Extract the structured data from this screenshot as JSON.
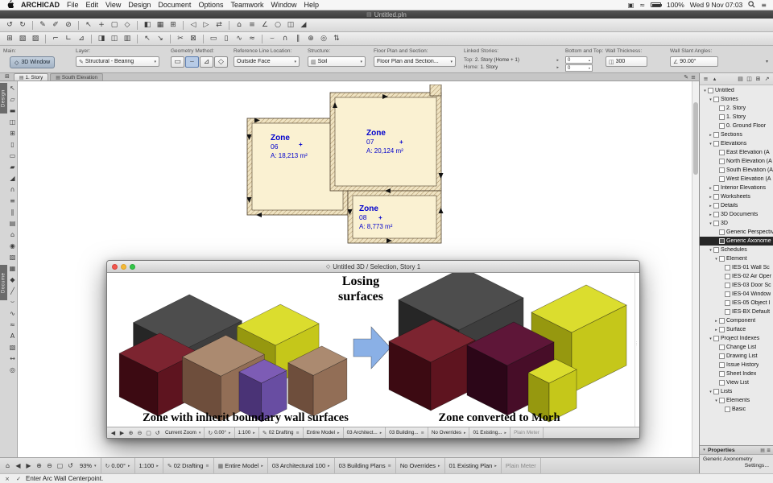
{
  "glyphs": {
    "chev_down": "▾",
    "chev_right": "▸",
    "chev_up": "▴",
    "menu": "≡",
    "cube": "◇",
    "pencil": "✎",
    "layers": "▥",
    "wall": "◫",
    "angle": "∠",
    "doc": "▤",
    "grid": "⊞",
    "wifi": "≈",
    "display": "▣",
    "dots": "⋮"
  },
  "colors": {
    "selection_highlight": "#262626",
    "zone_fill": "#faf1d2",
    "wall_hatch": "#a98f62",
    "zone_text": "#0000cd",
    "annotation_arrow_fill": "#8ab0e6",
    "annotation_arrow_stroke": "#3a66b0",
    "block_gray": "#4d4d4d",
    "block_maroon": "#5e141f",
    "block_brown": "#926e56",
    "block_purple": "#684da2",
    "block_yellow": "#c5c71a",
    "block_plum": "#470d28",
    "traffic_red": "#f2564d",
    "traffic_yellow": "#f5b935",
    "traffic_green": "#33c748"
  },
  "menubar": {
    "app_name": "ARCHICAD",
    "items": [
      "File",
      "Edit",
      "View",
      "Design",
      "Document",
      "Options",
      "Teamwork",
      "Window",
      "Help"
    ],
    "battery": "100%",
    "clock": "Wed 9 Nov 07:03"
  },
  "titlebar": {
    "title": "Untitled.pln"
  },
  "toolbar1_icons": [
    {
      "n": "undo-icon",
      "g": "↺"
    },
    {
      "n": "redo-icon",
      "g": "↻"
    },
    {
      "n": "separator"
    },
    {
      "n": "pen-icon",
      "g": "✎"
    },
    {
      "n": "pencil-icon",
      "g": "✐"
    },
    {
      "n": "eraser-icon",
      "g": "⊘"
    },
    {
      "n": "separator"
    },
    {
      "n": "arrow-select-icon",
      "g": "↖"
    },
    {
      "n": "add-vertex-icon",
      "g": "+"
    },
    {
      "n": "marquee-icon",
      "g": "▢"
    },
    {
      "n": "polygon-select-icon",
      "g": "◇"
    },
    {
      "n": "separator"
    },
    {
      "n": "layers-icon",
      "g": "◧"
    },
    {
      "n": "mesh-grid-icon",
      "g": "▦"
    },
    {
      "n": "snap-grid-icon",
      "g": "⊞"
    },
    {
      "n": "separator"
    },
    {
      "n": "previous-view-icon",
      "g": "◁"
    },
    {
      "n": "next-view-icon",
      "g": "▷"
    },
    {
      "n": "swap-view-icon",
      "g": "⇄"
    },
    {
      "n": "separator"
    },
    {
      "n": "home-story-icon",
      "g": "⌂"
    },
    {
      "n": "story-list-icon",
      "g": "≡"
    },
    {
      "n": "angle-icon",
      "g": "∠"
    },
    {
      "n": "circle-icon",
      "g": "○"
    },
    {
      "n": "door-icon",
      "g": "◫"
    },
    {
      "n": "roof-icon",
      "g": "◢"
    }
  ],
  "toolbar2_icons": [
    {
      "n": "grid-icon",
      "g": "⊞"
    },
    {
      "n": "hatch-icon",
      "g": "▧"
    },
    {
      "n": "hatch-alt-icon",
      "g": "▨"
    },
    {
      "n": "separator"
    },
    {
      "n": "trim-icon",
      "g": "⌐"
    },
    {
      "n": "adjust-icon",
      "g": "∟"
    },
    {
      "n": "slant-icon",
      "g": "⊿"
    },
    {
      "n": "separator"
    },
    {
      "n": "split-icon",
      "g": "◨"
    },
    {
      "n": "door-alt-icon",
      "g": "◫"
    },
    {
      "n": "layers-alt-icon",
      "g": "▥"
    },
    {
      "n": "separator"
    },
    {
      "n": "drag-icon",
      "g": "↖"
    },
    {
      "n": "stretch-icon",
      "g": "↘"
    },
    {
      "n": "separator"
    },
    {
      "n": "scissors-icon",
      "g": "✂"
    },
    {
      "n": "intersect-icon",
      "g": "⊠"
    },
    {
      "n": "separator"
    },
    {
      "n": "rectangle-icon",
      "g": "▭"
    },
    {
      "n": "column-icon",
      "g": "▯"
    },
    {
      "n": "polyline-icon",
      "g": "∿"
    },
    {
      "n": "spline-icon",
      "g": "≈"
    },
    {
      "n": "separator"
    },
    {
      "n": "arc-icon",
      "g": "⌣"
    },
    {
      "n": "shell-icon",
      "g": "∩"
    },
    {
      "n": "parallel-icon",
      "g": "∥"
    },
    {
      "n": "zoom-add-icon",
      "g": "⊕"
    },
    {
      "n": "camera-icon",
      "g": "◎"
    },
    {
      "n": "order-icon",
      "g": "⇅"
    }
  ],
  "infobox": {
    "section_label": "Main:",
    "tool_button": "3D Window",
    "layer_label": "Layer:",
    "layer_value": "Structural - Bearing",
    "geometry_label": "Geometry Method:",
    "geometry_buttons": [
      {
        "n": "geometry-straight-icon",
        "g": "▭"
      },
      {
        "n": "geometry-curved-icon",
        "g": "⌣",
        "sel": true
      },
      {
        "n": "geometry-trapezoid-icon",
        "g": "⊿"
      },
      {
        "n": "geometry-polygon-icon",
        "g": "◇"
      }
    ],
    "refline_label": "Reference Line Location:",
    "refline_value": "Outside Face",
    "structure_label": "Structure:",
    "structure_value": "Soil",
    "floorplan_label": "Floor Plan and Section:",
    "floorplan_value": "Floor Plan and Section...",
    "linked_label": "Linked Stories:",
    "top_label": "Top:",
    "top_value": "2. Story (Home + 1)",
    "home_label": "Home:",
    "home_value": "1. Story",
    "offsets_label": "Bottom and Top:",
    "offset_top": "0",
    "offset_bottom": "0",
    "thickness_label": "Wall Thickness:",
    "thickness_value": "300",
    "slant_label": "Wall Slant Angles:",
    "slant_value": "90.00°"
  },
  "tabs": {
    "active": "1. Story",
    "inactive": "South Elevation"
  },
  "toolbox": {
    "section_design": "Design",
    "section_document": "Docume",
    "icons": [
      {
        "n": "arrow-tool-icon",
        "g": "↖"
      },
      {
        "n": "marquee-tool-icon",
        "g": "▱"
      },
      {
        "n": "wall-tool-icon",
        "g": "▬"
      },
      {
        "n": "door-tool-icon",
        "g": "◫"
      },
      {
        "n": "window-tool-icon",
        "g": "⊞"
      },
      {
        "n": "column-tool-icon",
        "g": "▯"
      },
      {
        "n": "beam-tool-icon",
        "g": "▭"
      },
      {
        "n": "slab-tool-icon",
        "g": "▰"
      },
      {
        "n": "roof-tool-icon",
        "g": "◢"
      },
      {
        "n": "shell-tool-icon",
        "g": "∩"
      },
      {
        "n": "stair-tool-icon",
        "g": "≡"
      },
      {
        "n": "railing-tool-icon",
        "g": "∥"
      },
      {
        "n": "curtain-wall-tool-icon",
        "g": "▤"
      },
      {
        "n": "object-tool-icon",
        "g": "⌂"
      },
      {
        "n": "lamp-tool-icon",
        "g": "◉"
      },
      {
        "n": "zone-tool-icon",
        "g": "▨"
      },
      {
        "n": "mesh-tool-icon",
        "g": "▦"
      },
      {
        "n": "morph-tool-icon",
        "g": "◆"
      },
      {
        "n": "line-tool-icon",
        "g": "╱"
      },
      {
        "n": "arc-tool-icon",
        "g": "⌣"
      },
      {
        "n": "polyline-tool-icon",
        "g": "∿"
      },
      {
        "n": "spline-tool-icon",
        "g": "≈"
      },
      {
        "n": "text-tool-icon",
        "g": "A"
      },
      {
        "n": "fill-tool-icon",
        "g": "▧"
      },
      {
        "n": "dimension-tool-icon",
        "g": "↔"
      },
      {
        "n": "camera-tool-icon",
        "g": "◎"
      }
    ]
  },
  "plan": {
    "zones": [
      {
        "title": "Zone",
        "number": "06",
        "area": "A: 18,213 m²"
      },
      {
        "title": "Zone",
        "number": "07",
        "area": "A: 20,124 m²"
      },
      {
        "title": "Zone",
        "number": "08",
        "area": "A: 8,773 m²"
      }
    ],
    "handle_glyph": "+"
  },
  "viewer": {
    "title": "Untitled 3D / Selection, Story 1",
    "annotation_line1": "Losing",
    "annotation_line2": "surfaces",
    "caption_left": "Zone with inherit boundary wall surfaces",
    "caption_right": "Zone converted to Morh",
    "nav_icons": [
      {
        "n": "back-icon",
        "g": "◀"
      },
      {
        "n": "forward-icon",
        "g": "▶"
      },
      {
        "n": "zoom-in-icon",
        "g": "⊕"
      },
      {
        "n": "zoom-out-icon",
        "g": "⊖"
      },
      {
        "n": "fit-in-window-icon",
        "g": "▢"
      },
      {
        "n": "orbit-icon",
        "g": "↺"
      }
    ],
    "segments": [
      {
        "label": "Current Zoom",
        "chev": "▾"
      },
      {
        "icon": "↻",
        "label": "0.00°",
        "chev": "▸"
      },
      {
        "label": "1:100",
        "chev": "▸"
      },
      {
        "icon": "✎",
        "label": "02 Drafting",
        "chev": "≡"
      },
      {
        "label": "Entire Model",
        "chev": "▸"
      },
      {
        "label": "03 Architect...",
        "chev": "▸"
      },
      {
        "label": "03 Building...",
        "chev": "≡"
      },
      {
        "label": "No Overrides",
        "chev": "▸"
      },
      {
        "label": "01 Existing...",
        "chev": "▸"
      },
      {
        "label": "Plain Meter",
        "dim": true
      }
    ]
  },
  "navigator": {
    "top_left_icons": [
      {
        "n": "project-chooser-icon",
        "g": "≡"
      },
      {
        "n": "navigator-up-icon",
        "g": "▴"
      }
    ],
    "top_right_icons": [
      {
        "n": "project-map-icon",
        "g": "▤"
      },
      {
        "n": "view-map-icon",
        "g": "◫"
      },
      {
        "n": "layout-book-icon",
        "g": "⊞"
      },
      {
        "n": "publisher-icon",
        "g": "↗"
      }
    ],
    "items": [
      {
        "label": "Untitled",
        "indent": 0,
        "expander": "▾"
      },
      {
        "label": "Stories",
        "indent": 1,
        "expander": "▾"
      },
      {
        "label": "2. Story",
        "indent": 2
      },
      {
        "label": "1. Story",
        "indent": 2
      },
      {
        "label": "0. Ground Floor",
        "indent": 2
      },
      {
        "label": "Sections",
        "indent": 1,
        "expander": "▸"
      },
      {
        "label": "Elevations",
        "indent": 1,
        "expander": "▾"
      },
      {
        "label": "East Elevation (A",
        "indent": 2
      },
      {
        "label": "North Elevation (A",
        "indent": 2
      },
      {
        "label": "South Elevation (A",
        "indent": 2
      },
      {
        "label": "West Elevation (A",
        "indent": 2
      },
      {
        "label": "Interior Elevations",
        "indent": 1,
        "expander": "▸"
      },
      {
        "label": "Worksheets",
        "indent": 1,
        "expander": "▸"
      },
      {
        "label": "Details",
        "indent": 1,
        "expander": "▸"
      },
      {
        "label": "3D Documents",
        "indent": 1,
        "expander": "▸"
      },
      {
        "label": "3D",
        "indent": 1,
        "expander": "▾"
      },
      {
        "label": "Generic Perspectiv",
        "indent": 2
      },
      {
        "label": "Generic Axonome",
        "indent": 2,
        "selected": true
      },
      {
        "label": "Schedules",
        "indent": 1,
        "expander": "▾"
      },
      {
        "label": "Element",
        "indent": 2,
        "expander": "▾"
      },
      {
        "label": "IES-01 Wall Sc",
        "indent": 3
      },
      {
        "label": "IES-02 Air Oper",
        "indent": 3
      },
      {
        "label": "IES-03 Door Sc",
        "indent": 3
      },
      {
        "label": "IES-04 Window",
        "indent": 3
      },
      {
        "label": "IES-05 Object I",
        "indent": 3
      },
      {
        "label": "IES-BX Default",
        "indent": 3
      },
      {
        "label": "Component",
        "indent": 2,
        "expander": "▸"
      },
      {
        "label": "Surface",
        "indent": 2,
        "expander": "▸"
      },
      {
        "label": "Project Indexes",
        "indent": 1,
        "expander": "▾"
      },
      {
        "label": "Change List",
        "indent": 2
      },
      {
        "label": "Drawing List",
        "indent": 2
      },
      {
        "label": "Issue History",
        "indent": 2
      },
      {
        "label": "Sheet Index",
        "indent": 2
      },
      {
        "label": "View List",
        "indent": 2
      },
      {
        "label": "Lists",
        "indent": 1,
        "expander": "▾"
      },
      {
        "label": "Elements",
        "indent": 2,
        "expander": "▾"
      },
      {
        "label": "Basic",
        "indent": 3
      }
    ],
    "properties_header": "Properties",
    "properties_value": "Generic Axonometry",
    "settings_label": "Settings..."
  },
  "statusbar": {
    "nav_icons": [
      {
        "n": "home-icon",
        "g": "⌂"
      },
      {
        "n": "back-icon",
        "g": "◀"
      },
      {
        "n": "forward-icon",
        "g": "▶"
      },
      {
        "n": "zoom-in-icon",
        "g": "⊕"
      },
      {
        "n": "zoom-out-icon",
        "g": "⊖"
      },
      {
        "n": "fit-in-window-icon",
        "g": "▢"
      },
      {
        "n": "orbit-icon",
        "g": "↺"
      }
    ],
    "segments": [
      {
        "label": "93%",
        "chev": "▾"
      },
      {
        "icon": "↻",
        "label": "0.00°",
        "chev": "▸"
      },
      {
        "label": "1:100",
        "chev": "▸"
      },
      {
        "icon": "✎",
        "label": "02 Drafting",
        "chev": "≡"
      },
      {
        "icon": "▦",
        "label": "Entire Model",
        "chev": "▸"
      },
      {
        "label": "03 Architectural 100",
        "chev": "▸"
      },
      {
        "label": "03 Building Plans",
        "chev": "≡"
      },
      {
        "label": "No Overrides",
        "chev": "▸"
      },
      {
        "label": "01 Existing Plan",
        "chev": "▸"
      },
      {
        "label": "Plain Meter",
        "dim": true
      }
    ]
  },
  "hintbar": {
    "hint": "Enter Arc Wall Centerpoint."
  }
}
